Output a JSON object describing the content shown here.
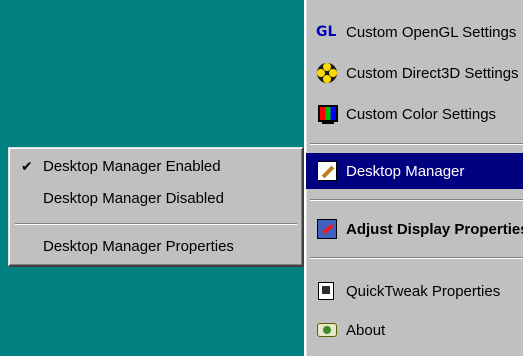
{
  "main_menu": {
    "items": [
      {
        "label": "Custom OpenGL Settings",
        "icon": "opengl-icon",
        "icon_text": "GL"
      },
      {
        "label": "Custom Direct3D Settings",
        "icon": "direct3d-icon"
      },
      {
        "label": "Custom Color Settings",
        "icon": "monitor-color-icon"
      },
      {
        "label": "Desktop Manager",
        "icon": "desktop-manager-icon"
      },
      {
        "label": "Adjust Display Properties",
        "icon": "adjust-display-icon"
      },
      {
        "label": "QuickTweak Properties",
        "icon": "quicktweak-icon"
      },
      {
        "label": "About",
        "icon": "about-icon"
      }
    ]
  },
  "submenu": {
    "items": [
      {
        "label": "Desktop Manager Enabled",
        "check": "✔"
      },
      {
        "label": "Desktop Manager Disabled",
        "check": ""
      },
      {
        "label": "Desktop Manager Properties",
        "check": ""
      }
    ]
  },
  "colors": {
    "desktop": "#008080",
    "menu": "#c0c0c0",
    "highlight": "#000080"
  }
}
